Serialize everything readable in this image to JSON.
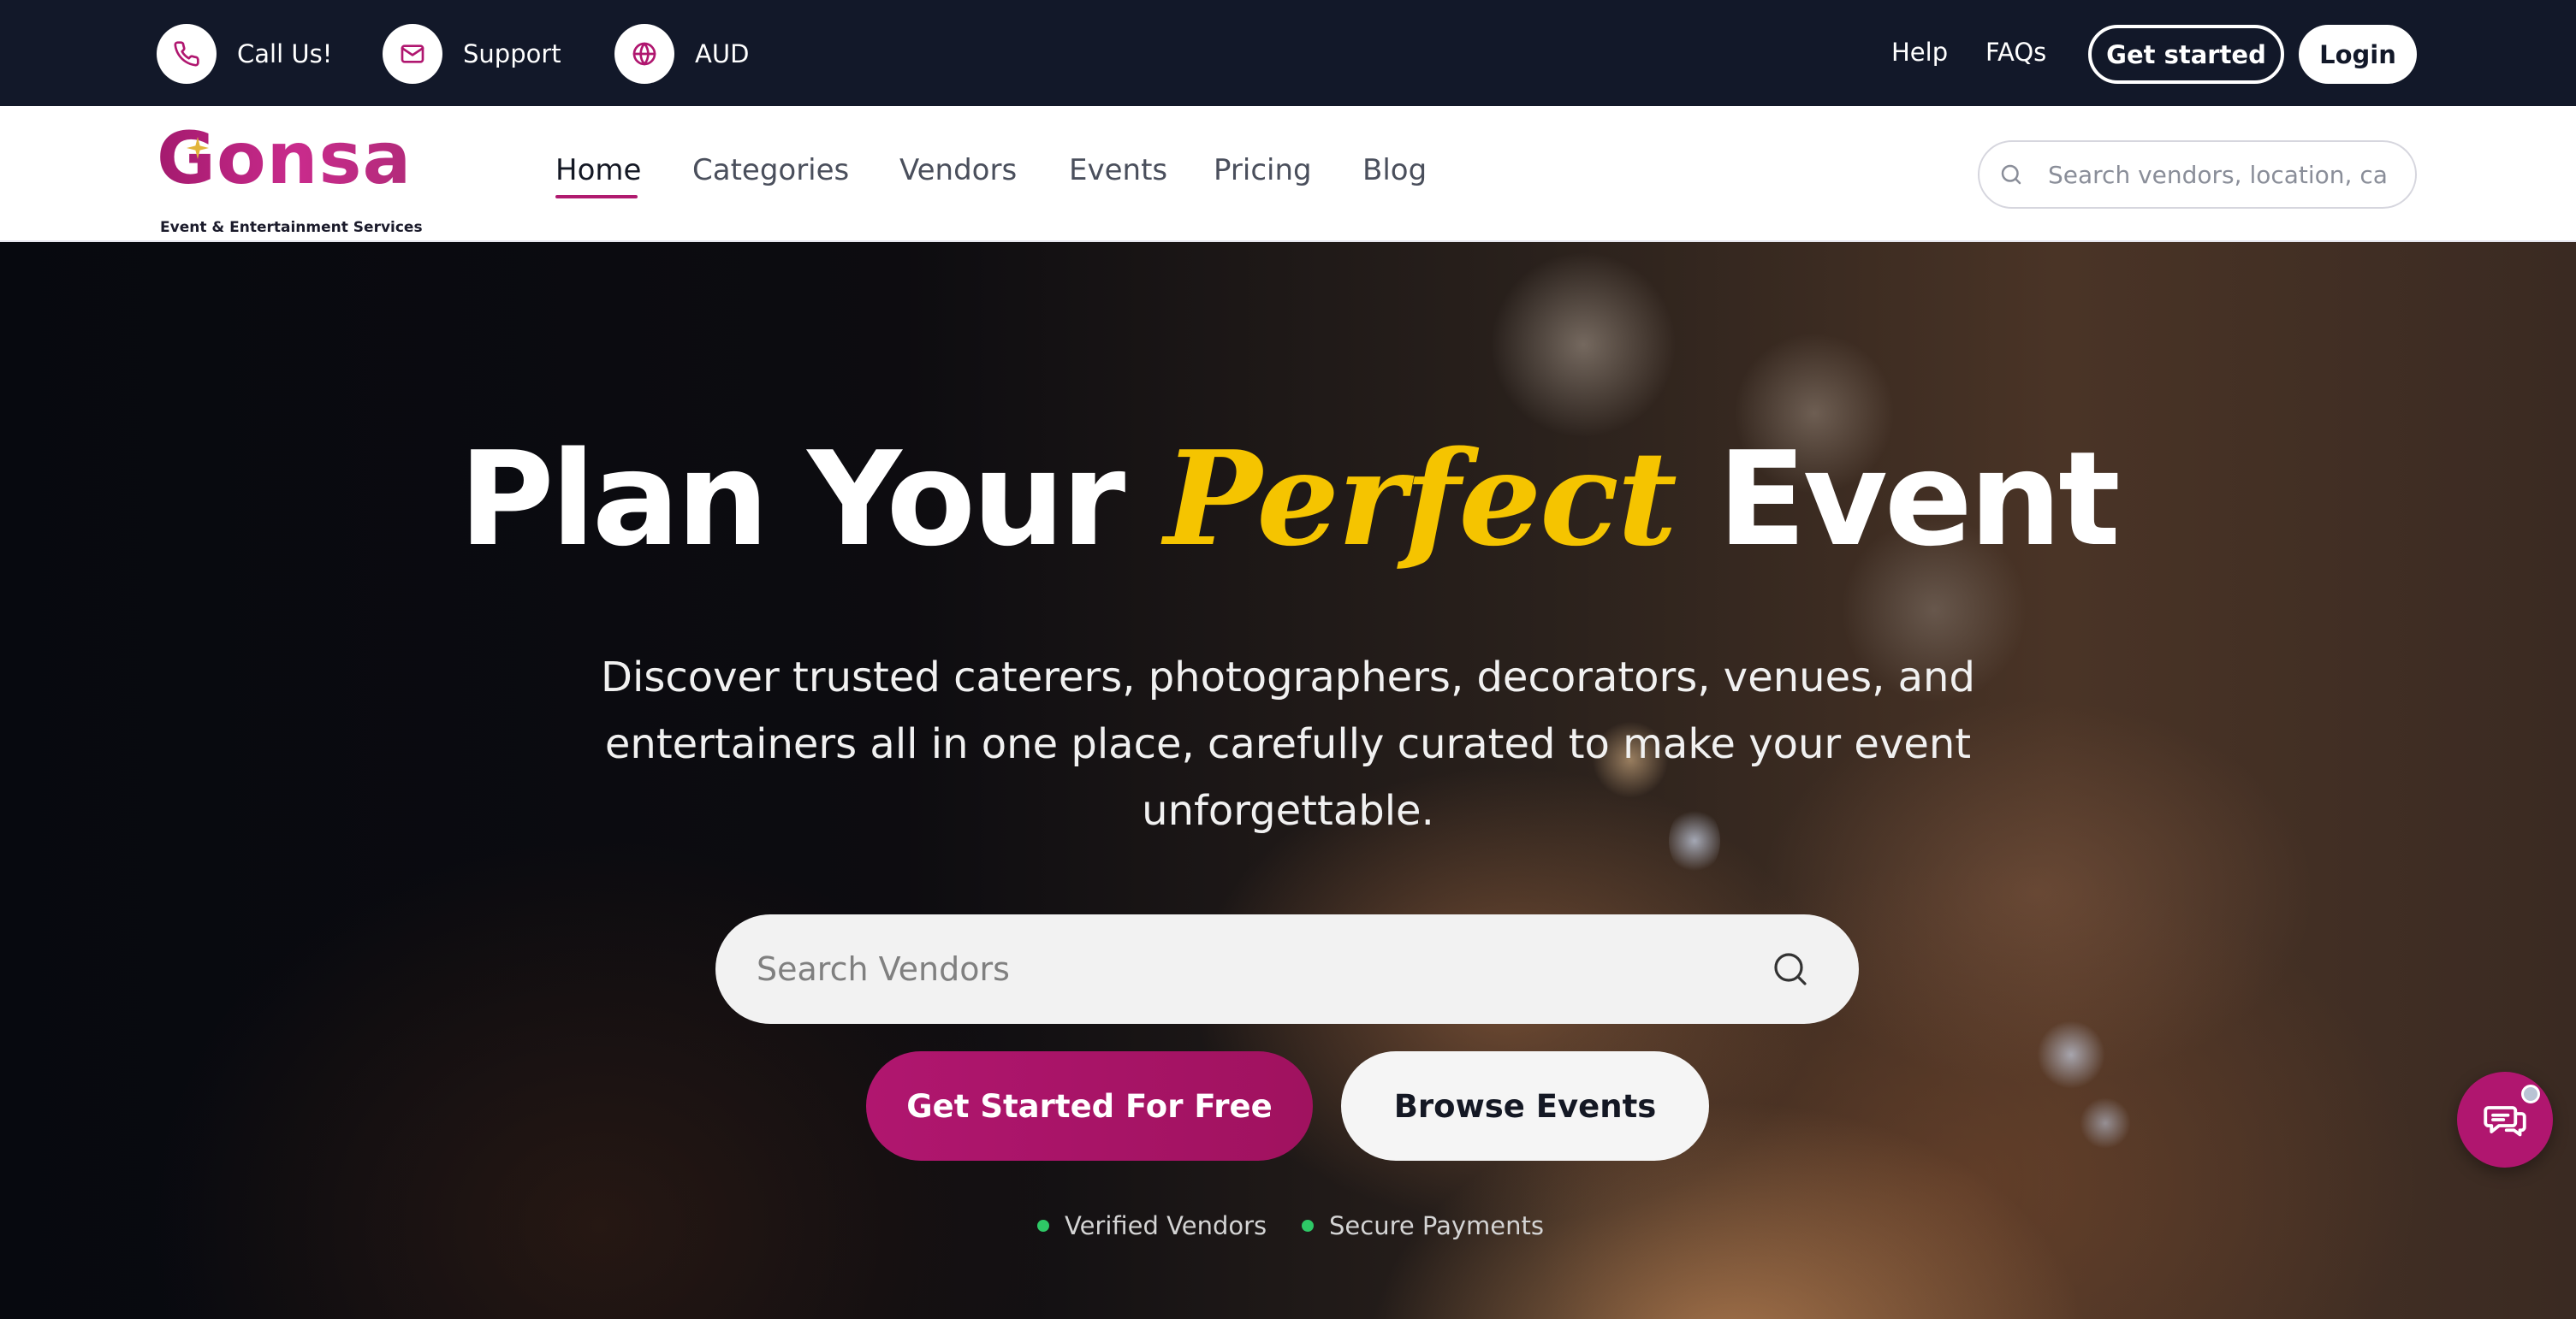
{
  "topbar": {
    "call_label": "Call Us!",
    "support_label": "Support",
    "currency_label": "AUD",
    "help_label": "Help",
    "faqs_label": "FAQs",
    "get_started_label": "Get started",
    "login_label": "Login"
  },
  "brand": {
    "name": "Gonsa",
    "tagline": "Event & Entertainment Services",
    "color": "#b01a6f"
  },
  "nav": {
    "items": [
      {
        "label": "Home",
        "active": true
      },
      {
        "label": "Categories"
      },
      {
        "label": "Vendors"
      },
      {
        "label": "Events"
      },
      {
        "label": "Pricing"
      },
      {
        "label": "Blog"
      }
    ],
    "search_placeholder": "Search vendors, location, ca"
  },
  "hero": {
    "title_part1": "Plan Your",
    "title_accent": "Perfect",
    "title_part2": "Event",
    "accent_color": "#f5c400",
    "subtitle": "Discover trusted caterers, photographers, decorators, venues, and entertainers all in one place, carefully curated to make your event unforgettable.",
    "search_placeholder": "Search Vendors",
    "cta_primary": "Get Started For Free",
    "cta_secondary": "Browse Events",
    "trust_items": [
      "Verified Vendors",
      "Secure Payments"
    ],
    "trust_dot_color": "#2ec866"
  },
  "icons": {
    "call": "phone-icon",
    "support": "mail-icon",
    "currency": "globe-icon",
    "nav_search": "search-icon",
    "hero_search": "search-icon",
    "chat": "chat-icon"
  }
}
